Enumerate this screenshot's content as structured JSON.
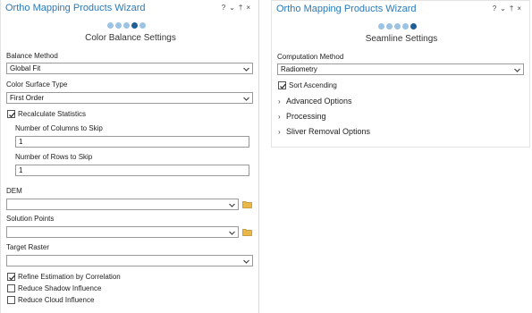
{
  "left_panel": {
    "title": "Ortho Mapping Products Wizard",
    "window_icons": [
      "?",
      "⌄",
      "†",
      "×"
    ],
    "section_title": "Color Balance Settings",
    "balance_method": {
      "label": "Balance Method",
      "value": "Global Fit"
    },
    "color_surface_type": {
      "label": "Color Surface Type",
      "value": "First Order"
    },
    "recalculate_statistics": {
      "label": "Recalculate Statistics",
      "checked": true
    },
    "columns_to_skip": {
      "label": "Number of Columns to Skip",
      "value": "1"
    },
    "rows_to_skip": {
      "label": "Number of Rows to Skip",
      "value": "1"
    },
    "dem": {
      "label": "DEM",
      "value": ""
    },
    "solution_points": {
      "label": "Solution Points",
      "value": ""
    },
    "target_raster": {
      "label": "Target Raster",
      "value": ""
    },
    "refine_estimation": {
      "label": "Refine Estimation by Correlation",
      "checked": true
    },
    "reduce_shadow": {
      "label": "Reduce Shadow Influence",
      "checked": false
    },
    "reduce_cloud": {
      "label": "Reduce Cloud Influence",
      "checked": false
    }
  },
  "right_panel": {
    "title": "Ortho Mapping Products Wizard",
    "window_icons": [
      "?",
      "⌄",
      "†",
      "×"
    ],
    "section_title": "Seamline Settings",
    "computation_method": {
      "label": "Computation Method",
      "value": "Radiometry"
    },
    "sort_ascending": {
      "label": "Sort Ascending",
      "checked": true
    },
    "advanced_options": {
      "label": "Advanced Options"
    },
    "processing": {
      "label": "Processing"
    },
    "sliver_removal": {
      "label": "Sliver Removal Options"
    }
  },
  "colors": {
    "title_blue": "#2a7ab8",
    "step_inactive": "#9cc3e3",
    "step_active": "#1f5f96",
    "folder_yellow": "#e8b94a"
  }
}
